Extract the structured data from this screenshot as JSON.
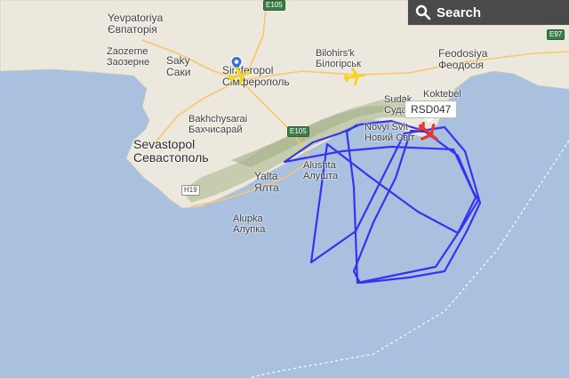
{
  "search": {
    "label": "Search",
    "icon": "search-icon"
  },
  "flight": {
    "callsign": "RSD047"
  },
  "colors": {
    "sea": "#a9c1df",
    "land": "#ece8de",
    "track": "#3434f0",
    "selected_plane": "#e53935",
    "other_planes": "#f6d41d",
    "search_bg": "#4a4a4a"
  },
  "cities": [
    {
      "id": "yevpatoriya",
      "lines": [
        "Yevpatoriya",
        "Євпаторія"
      ]
    },
    {
      "id": "zaozerne",
      "lines": [
        "Zaozerne",
        "Заозерне"
      ]
    },
    {
      "id": "saky",
      "lines": [
        "Saky",
        "Саки"
      ]
    },
    {
      "id": "simferopol",
      "lines": [
        "Simferopol",
        "Сімферополь"
      ]
    },
    {
      "id": "bilohirsk",
      "lines": [
        "Bilohirs'k",
        "Білогірськ"
      ]
    },
    {
      "id": "feodosiya",
      "lines": [
        "Feodosiya",
        "Феодосія"
      ]
    },
    {
      "id": "bakhchysarai",
      "lines": [
        "Bakhchysarai",
        "Бахчисарай"
      ]
    },
    {
      "id": "sevastopol",
      "lines": [
        "Sevastopol",
        "Севастополь"
      ]
    },
    {
      "id": "sudak",
      "lines": [
        "Sudak",
        "Судак"
      ]
    },
    {
      "id": "novyi-svit",
      "lines": [
        "Novyi Svit",
        "Новий Світ"
      ]
    },
    {
      "id": "koktebel",
      "lines": [
        "Koktebel"
      ]
    },
    {
      "id": "alushta",
      "lines": [
        "Alushta",
        "Алушта"
      ]
    },
    {
      "id": "yalta",
      "lines": [
        "Yalta",
        "Ялта"
      ]
    },
    {
      "id": "alupka",
      "lines": [
        "Alupka",
        "Алупка"
      ]
    }
  ],
  "roads": {
    "e105_top": "E105",
    "e105_mid": "E105",
    "h19": "H19",
    "e97": "E97"
  }
}
